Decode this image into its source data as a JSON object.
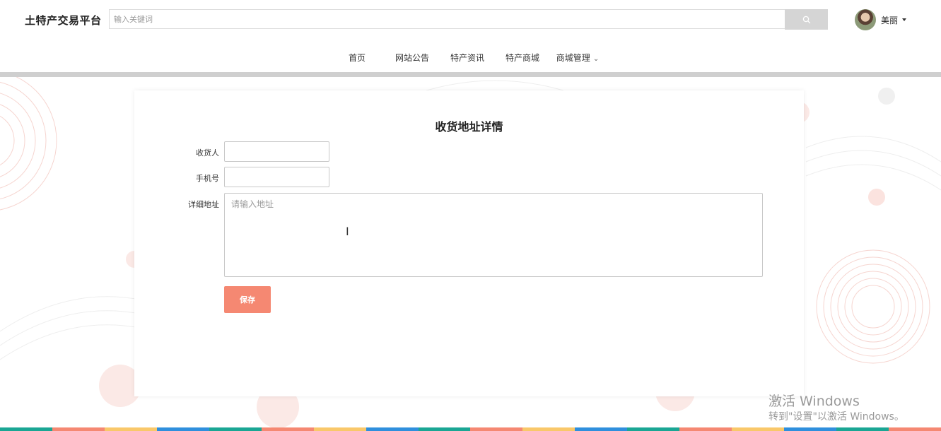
{
  "header": {
    "logo": "土特产交易平台",
    "search_placeholder": "输入关键词",
    "search_icon": "search-icon",
    "user_name": "美丽"
  },
  "nav": {
    "items": [
      {
        "label": "首页",
        "color": "#1aa694"
      },
      {
        "label": "网站公告",
        "color": "#f58872"
      },
      {
        "label": "特产资讯",
        "color": "#f9c86a"
      },
      {
        "label": "特产商城",
        "color": "#2f8fdd"
      },
      {
        "label": "商城管理",
        "color": "#1aa694",
        "has_dropdown": true
      }
    ]
  },
  "form": {
    "title": "收货地址详情",
    "receiver_label": "收货人",
    "receiver_value": "",
    "phone_label": "手机号",
    "phone_value": "",
    "address_label": "详细地址",
    "address_placeholder": "请输入地址",
    "save_label": "保存"
  },
  "watermark": {
    "title": "激活 Windows",
    "subtitle": "转到\"设置\"以激活 Windows。"
  },
  "colors": {
    "accent": "#f58872",
    "teal": "#1aa694",
    "yellow": "#f9c86a",
    "blue": "#2f8fdd",
    "gray_line": "#cfcfcf"
  }
}
